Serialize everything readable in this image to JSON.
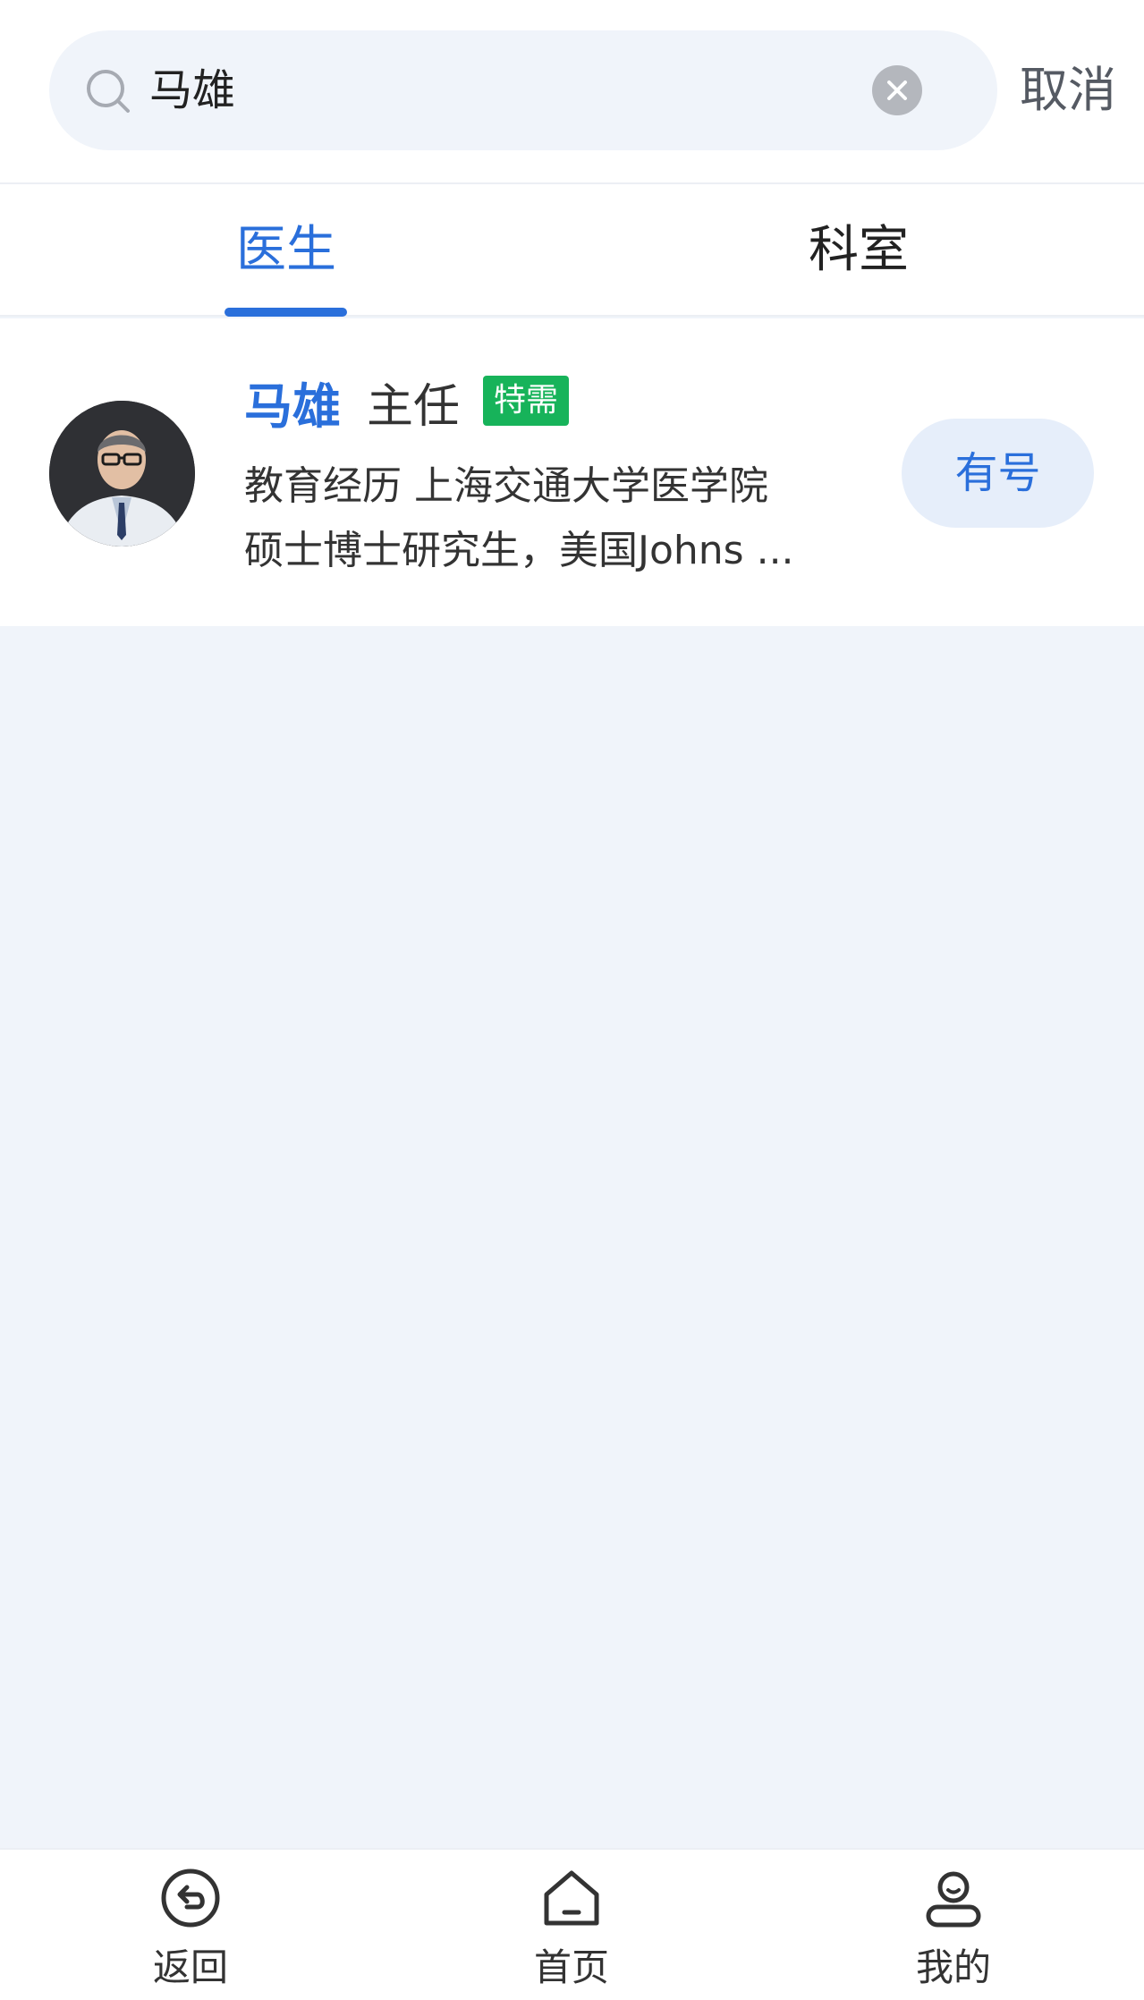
{
  "search": {
    "value": "马雄",
    "cancel_label": "取消"
  },
  "tabs": [
    {
      "label": "医生",
      "active": true
    },
    {
      "label": "科室",
      "active": false
    }
  ],
  "results": [
    {
      "name": "马雄",
      "title": "主任",
      "tag": "特需",
      "desc_line1": "教育经历 上海交通大学医学院",
      "desc_line2": "硕士博士研究生，美国Johns ...",
      "availability": "有号"
    }
  ],
  "nav": {
    "back_label": "返回",
    "home_label": "首页",
    "mine_label": "我的"
  },
  "colors": {
    "accent": "#2a6fdb",
    "tag_green": "#17b35a",
    "background": "#f0f4fa"
  }
}
